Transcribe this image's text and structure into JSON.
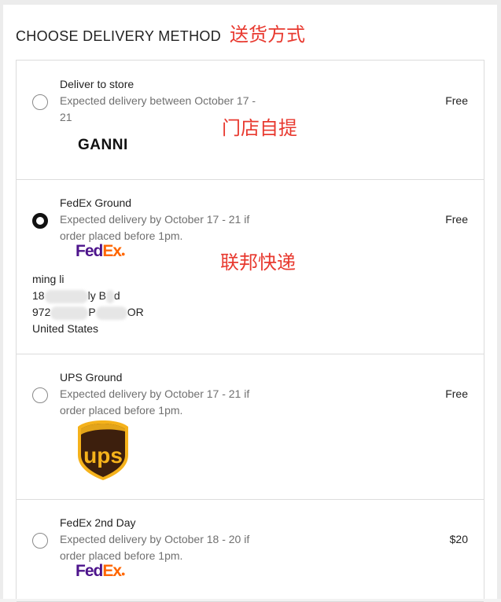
{
  "heading": "CHOOSE DELIVERY METHOD",
  "annotations": {
    "delivery_method": "送货方式",
    "store_pickup": "门店自提",
    "fedex": "联邦快递"
  },
  "options": [
    {
      "title": "Deliver to store",
      "desc": "Expected delivery between October 17 - 21",
      "price": "Free",
      "selected": false,
      "logo_text": "GANNI"
    },
    {
      "title": "FedEx Ground",
      "desc": "Expected delivery by October 17 - 21 if order placed before 1pm.",
      "price": "Free",
      "selected": true,
      "logo": {
        "fed": "Fed",
        "ex": "Ex"
      },
      "address": {
        "name": "ming li",
        "line1_a": "18",
        "line1_b": "ly B",
        "line1_c": "d",
        "line2_a": "972",
        "line2_b": "P",
        "line2_c": "OR",
        "country": "United States"
      }
    },
    {
      "title": "UPS Ground",
      "desc": "Expected delivery by October 17 - 21 if order placed before 1pm.",
      "price": "Free",
      "selected": false,
      "logo_text": "ups"
    },
    {
      "title": "FedEx 2nd Day",
      "desc": "Expected delivery by October 18 - 20 if order placed before 1pm.",
      "price": "$20",
      "selected": false,
      "logo": {
        "fed": "Fed",
        "ex": "Ex"
      }
    }
  ],
  "colors": {
    "annotation_red": "#e8392f",
    "fedex_purple": "#4d148c",
    "fedex_orange": "#ff6600",
    "ups_brown": "#3d1f0d",
    "ups_gold": "#f5b21b"
  }
}
